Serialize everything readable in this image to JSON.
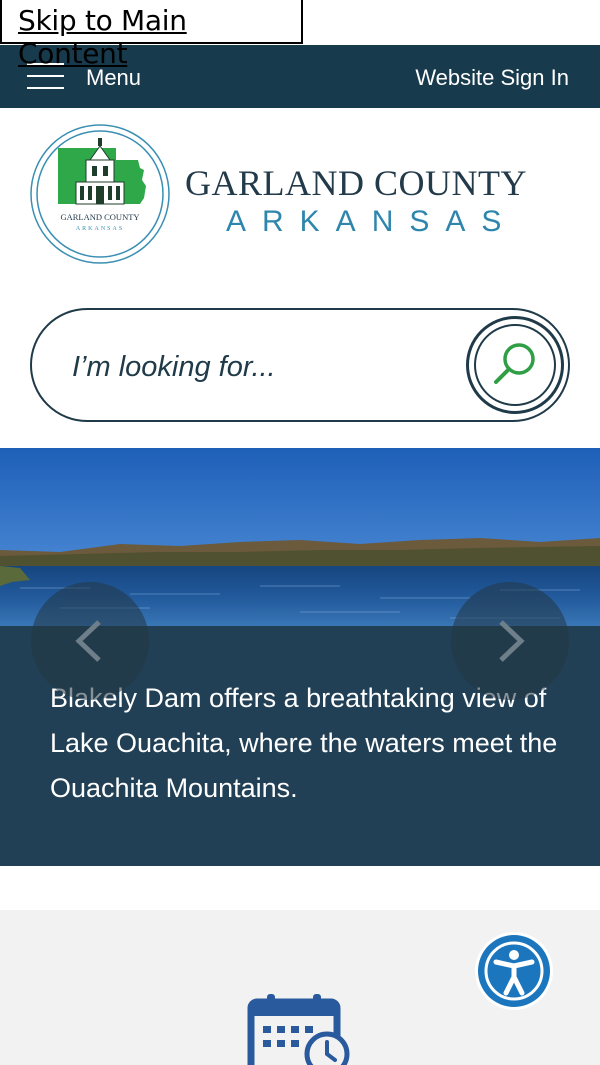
{
  "skip_link": {
    "label": "Skip to Main Content"
  },
  "topbar": {
    "menu_label": "Menu",
    "signin_label": "Website Sign In"
  },
  "header": {
    "county_name": "GARLAND COUNTY",
    "state_name": "ARKANSAS",
    "seal_text": "GARLAND COUNTY ARKANSAS"
  },
  "search": {
    "placeholder": "I’m looking for..."
  },
  "hero": {
    "caption": "Blakely Dam offers a breathtaking view of Lake Ouachita, where the waters meet the Ouachita Mountains."
  },
  "icons": {
    "menu": "hamburger-icon",
    "search": "magnifier-icon",
    "prev": "chevron-left-icon",
    "next": "chevron-right-icon",
    "accessibility": "accessibility-icon",
    "calendar": "calendar-clock-icon"
  },
  "colors": {
    "navy": "#173a4d",
    "caption_bg": "#224055",
    "accent_blue": "#2f86ad",
    "accessibility_blue": "#1c76bd",
    "seal_green": "#2fa84a"
  }
}
